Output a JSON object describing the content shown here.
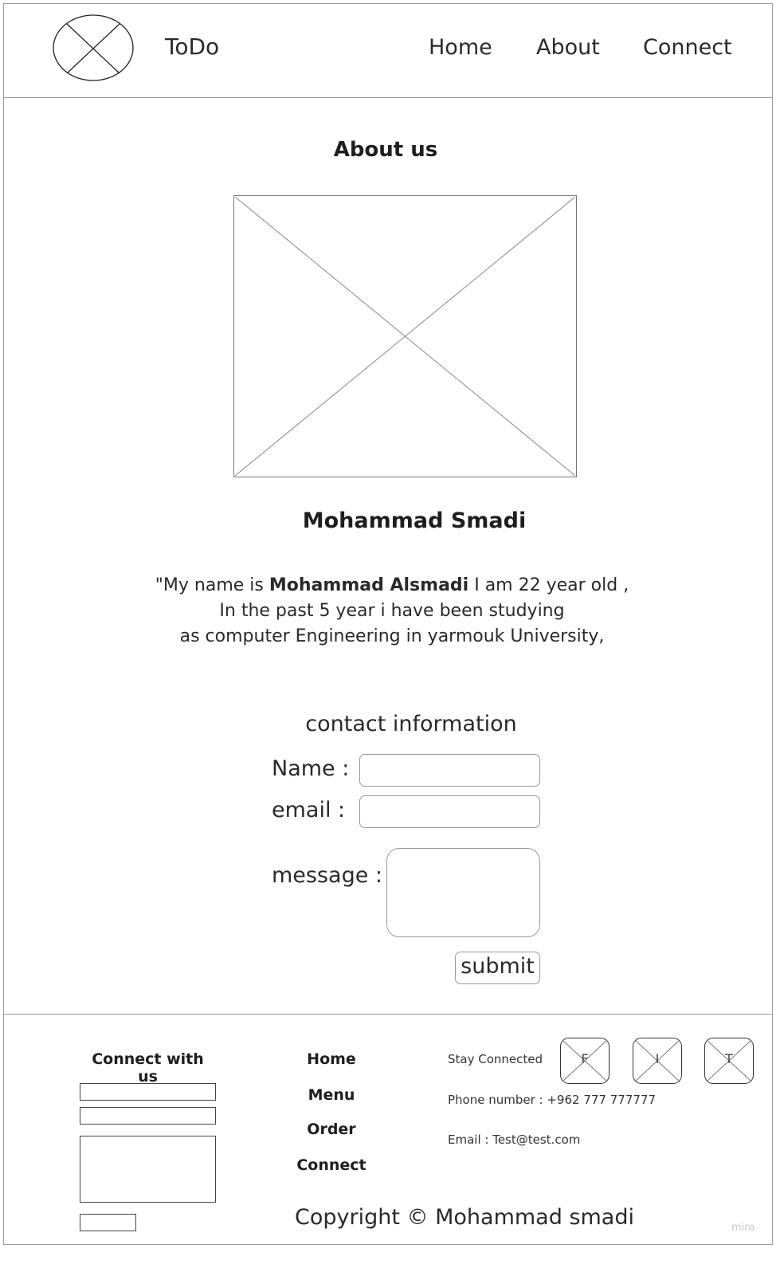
{
  "header": {
    "app_title": "ToDo",
    "nav": [
      "Home",
      "About",
      "Connect"
    ]
  },
  "main": {
    "section_title": "About us",
    "person_name": "Mohammad Smadi",
    "bio": {
      "line1_prefix": "\"My name is ",
      "line1_bold": "Mohammad Alsmadi",
      "line1_suffix": " I am 22 year old ,",
      "line2": "In the past 5 year i have been studying",
      "line3": "as computer Engineering in yarmouk University,"
    }
  },
  "contact": {
    "title": "contact information",
    "name_label": "Name :",
    "email_label": "email :",
    "message_label": "message :",
    "submit_label": "submit"
  },
  "footer": {
    "connect_title": "Connect with us",
    "links": [
      "Home",
      "Menu",
      "Order",
      "Connect"
    ],
    "stay_connected": "Stay Connected",
    "social": [
      "F",
      "I",
      "T"
    ],
    "phone": "Phone number : +962 777 777777",
    "email": "Email : Test@test.com",
    "copyright": "Copyright © Mohammad smadi",
    "watermark": "miro"
  }
}
